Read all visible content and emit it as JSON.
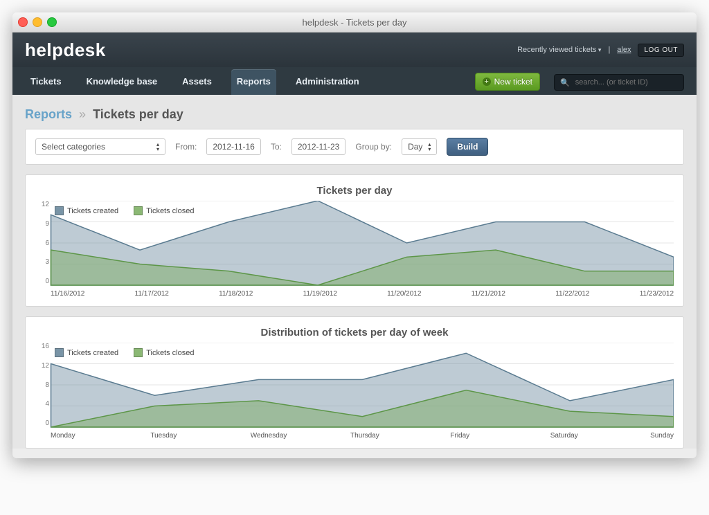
{
  "window": {
    "title": "helpdesk - Tickets per day"
  },
  "brand": "helpdesk",
  "header": {
    "recent": "Recently viewed tickets",
    "user": "alex",
    "logout": "LOG OUT"
  },
  "nav": {
    "tickets": "Tickets",
    "kb": "Knowledge base",
    "assets": "Assets",
    "reports": "Reports",
    "admin": "Administration",
    "new_ticket": "New ticket"
  },
  "search": {
    "placeholder": "search... (or ticket ID)"
  },
  "breadcrumb": {
    "root": "Reports",
    "sep": "»",
    "leaf": "Tickets per day"
  },
  "filters": {
    "categories": "Select categories",
    "from_label": "From:",
    "from": "2012-11-16",
    "to_label": "To:",
    "to": "2012-11-23",
    "group_label": "Group by:",
    "group": "Day",
    "build": "Build"
  },
  "legend": {
    "created": "Tickets created",
    "closed": "Tickets closed"
  },
  "chart_data": [
    {
      "type": "area",
      "title": "Tickets per day",
      "xlabel": "",
      "ylabel": "",
      "ylim": [
        0,
        12
      ],
      "yticks": [
        12,
        9,
        6,
        3,
        0
      ],
      "categories": [
        "11/16/2012",
        "11/17/2012",
        "11/18/2012",
        "11/19/2012",
        "11/20/2012",
        "11/21/2012",
        "11/22/2012",
        "11/23/2012"
      ],
      "series": [
        {
          "name": "Tickets created",
          "values": [
            10,
            5,
            9,
            12,
            6,
            9,
            9,
            4
          ]
        },
        {
          "name": "Tickets closed",
          "values": [
            5,
            3,
            2,
            0,
            4,
            5,
            2,
            2
          ]
        }
      ]
    },
    {
      "type": "area",
      "title": "Distribution of tickets per day of week",
      "xlabel": "",
      "ylabel": "",
      "ylim": [
        0,
        16
      ],
      "yticks": [
        16,
        12,
        8,
        4,
        0
      ],
      "categories": [
        "Monday",
        "Tuesday",
        "Wednesday",
        "Thursday",
        "Friday",
        "Saturday",
        "Sunday"
      ],
      "series": [
        {
          "name": "Tickets created",
          "values": [
            12,
            6,
            9,
            9,
            14,
            5,
            9
          ]
        },
        {
          "name": "Tickets closed",
          "values": [
            0,
            4,
            5,
            2,
            7,
            3,
            2
          ]
        }
      ]
    }
  ]
}
